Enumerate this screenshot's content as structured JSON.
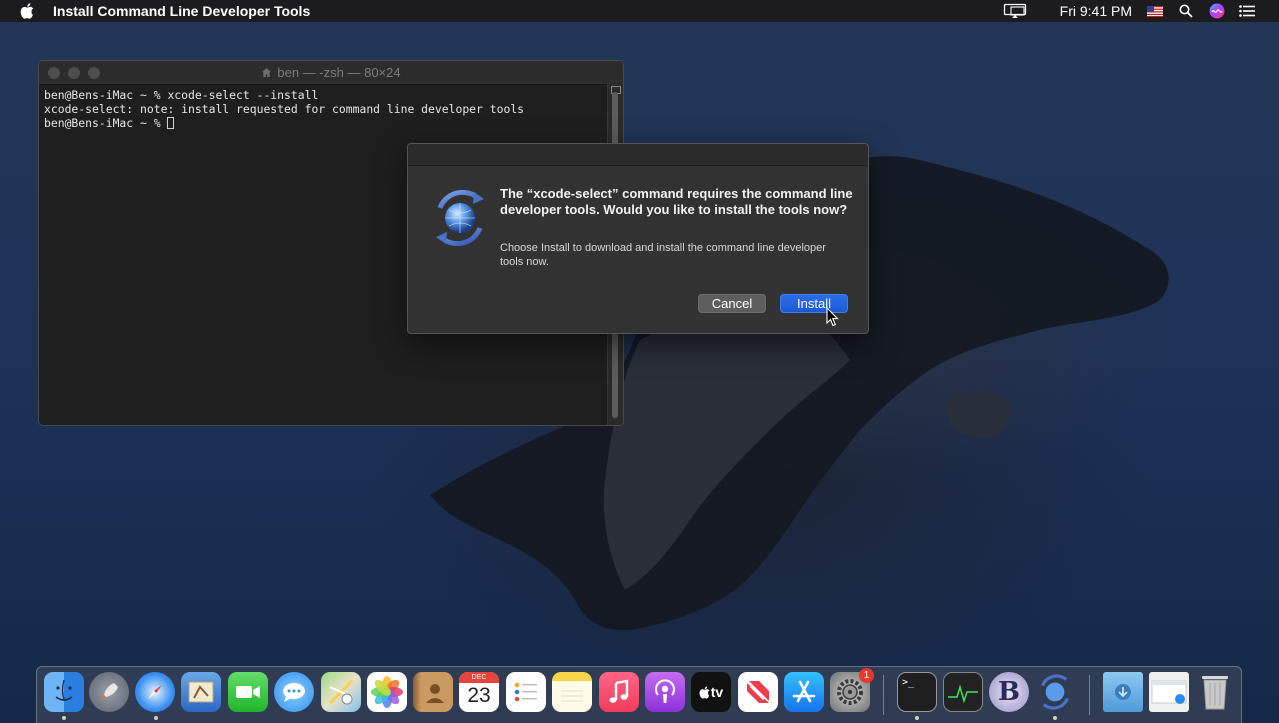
{
  "menubar": {
    "app_title": "Install Command Line Developer Tools",
    "clock": "Fri 9:41 PM",
    "status_icons": [
      "airplay-display-icon",
      "us-flag-icon",
      "spotlight-search-icon",
      "siri-icon",
      "notification-center-icon"
    ]
  },
  "terminal": {
    "title": "ben — -zsh — 80×24",
    "lines": [
      "ben@Bens-iMac ~ % xcode-select --install",
      "xcode-select: note: install requested for command line developer tools",
      "ben@Bens-iMac ~ % "
    ]
  },
  "dialog": {
    "heading": "The “xcode-select” command requires the command line developer tools. Would you like to install the tools now?",
    "body": "Choose Install to download and install the command line developer tools now.",
    "cancel_label": "Cancel",
    "install_label": "Install"
  },
  "dock": {
    "calendar_month": "DEC",
    "calendar_day": "23",
    "tv_label": "tv",
    "bbedit_letter": "B",
    "system_prefs_badge": "1",
    "apps": [
      "Finder",
      "Launchpad",
      "Safari",
      "Mail",
      "FaceTime",
      "Messages",
      "Maps",
      "Photos",
      "Contacts",
      "Calendar",
      "Reminders",
      "Notes",
      "Music",
      "Podcasts",
      "TV",
      "News",
      "App Store",
      "System Preferences",
      "Terminal",
      "Activity Monitor",
      "BBEdit",
      "Software Update",
      "Downloads",
      "Documents",
      "Trash"
    ]
  },
  "colors": {
    "install_button": "#1a5ad6",
    "cancel_button": "#5e5e5e",
    "dialog_bg": "#323232",
    "terminal_bg": "#1e1e1e",
    "menubar_bg": "#1c1c1e"
  }
}
